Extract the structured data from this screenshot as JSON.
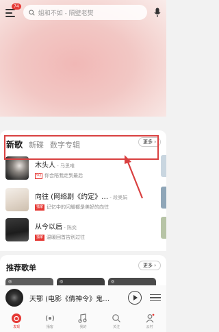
{
  "header": {
    "menu_badge": "74",
    "search_placeholder": "姐和不如 - 隔壁老樊"
  },
  "new_songs": {
    "tabs": [
      {
        "label": "新歌",
        "active": true
      },
      {
        "label": "新碟",
        "active": false
      },
      {
        "label": "数字专辑",
        "active": false
      }
    ],
    "more_label": "更多",
    "items": [
      {
        "title": "木头人",
        "artist": " - 马思唯",
        "tag": "SQ",
        "subtitle": "你会陪我走到最后"
      },
      {
        "title": "向往 (网络剧《约定》…",
        "artist": " - 段奥娟",
        "tag": "独家",
        "subtitle": "记忆中的闪耀都是美好的向往"
      },
      {
        "title": "从今以后",
        "artist": " - 陈奕",
        "tag": "独家",
        "subtitle": "温暖回首告别过往"
      }
    ]
  },
  "playlists": {
    "title": "推荐歌单",
    "more_label": "更多",
    "thumbs": [
      "◎",
      "◎",
      "◎"
    ]
  },
  "player": {
    "title": "天鄂 (电影《倩神令》鬼…"
  },
  "bottom_nav": [
    {
      "label": "发现",
      "icon": "netease-logo-icon",
      "active": true
    },
    {
      "label": "播客",
      "icon": "radio-icon",
      "active": false
    },
    {
      "label": "我的",
      "icon": "music-note-icon",
      "active": false
    },
    {
      "label": "关注",
      "icon": "follow-icon",
      "active": false
    },
    {
      "label": "云村",
      "icon": "community-icon",
      "active": false
    }
  ],
  "colors": {
    "accent": "#e53935",
    "highlight_box": "#d94040"
  }
}
